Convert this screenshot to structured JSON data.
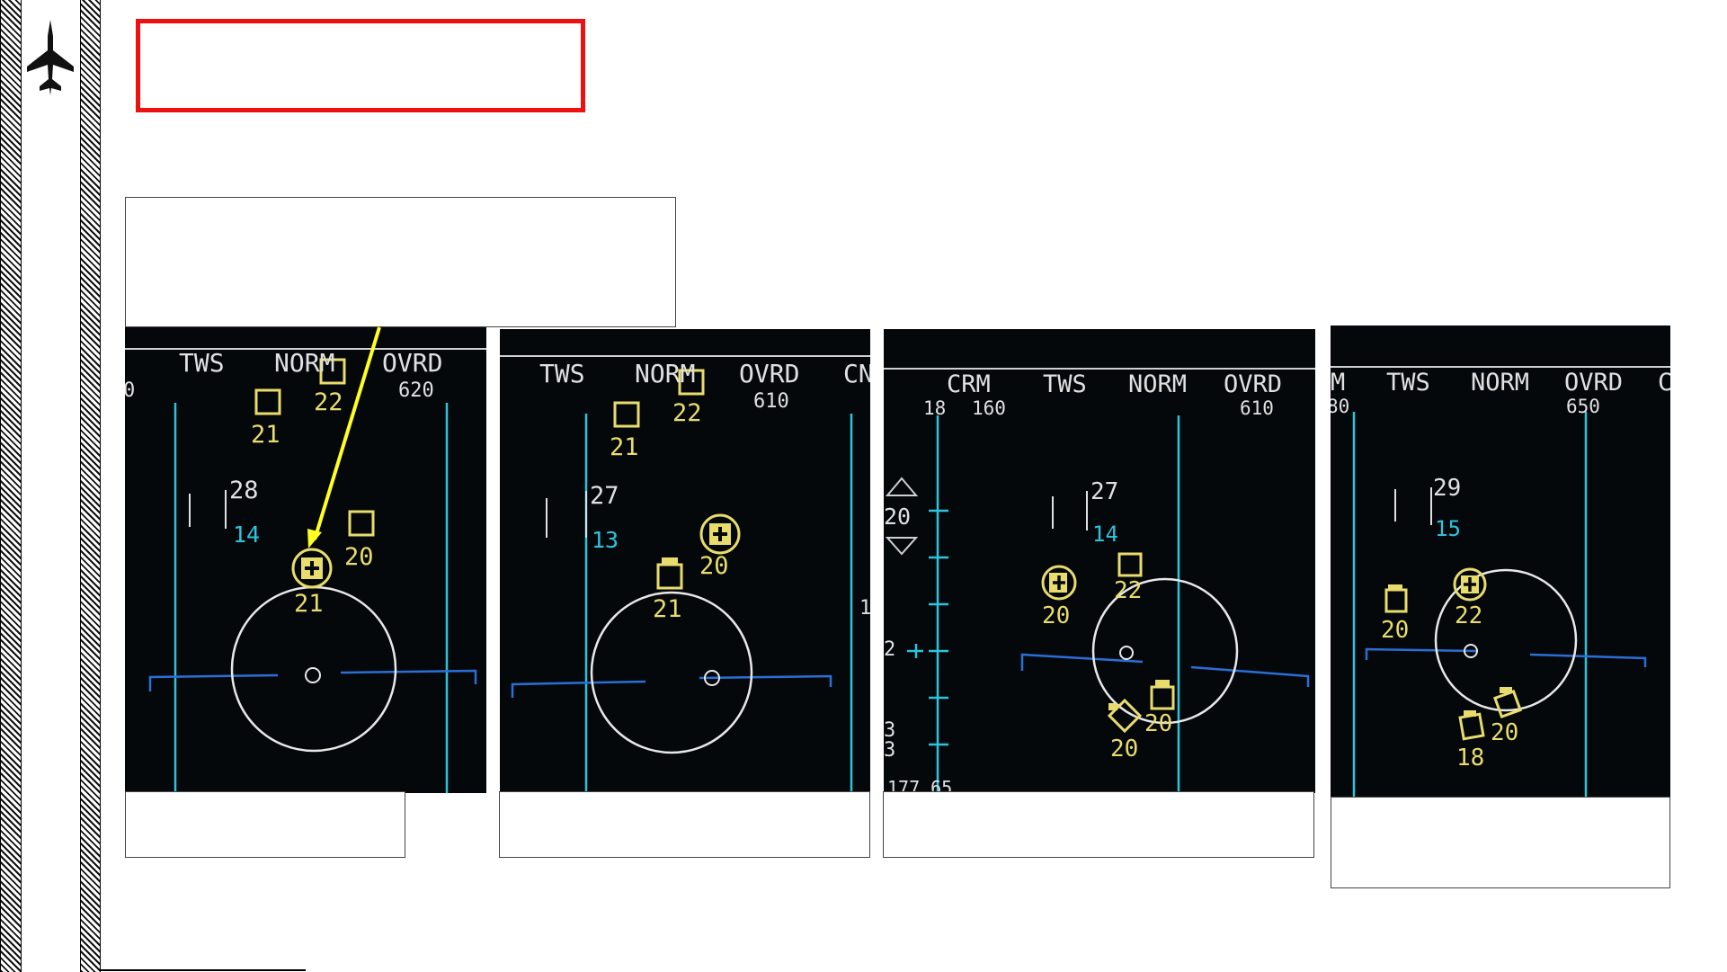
{
  "colors": {
    "title_box_border": "#ee1111",
    "panel_bg": "#05080b",
    "symbol_yellow": "#e8dc6c",
    "scale_cyan": "#2ec3dc",
    "text_white": "#e0e0e0",
    "pointer_arrow": "#ffff22"
  },
  "sidebar": {
    "logo_icon": "jet-aircraft-icon"
  },
  "panels": [
    {
      "header": {
        "left": "0",
        "mode1": "TWS",
        "mode2": "NORM",
        "mode3": "OVRD",
        "range": "620"
      },
      "aspect": {
        "top": "28",
        "bottom": "14"
      },
      "contacts": [
        {
          "label": "21",
          "kind": "square"
        },
        {
          "label": "22",
          "kind": "square"
        },
        {
          "label": "20",
          "kind": "square"
        },
        {
          "label": "21",
          "kind": "tracked"
        }
      ]
    },
    {
      "header": {
        "mode1": "TWS",
        "mode2": "NORM",
        "mode3": "OVRD",
        "right": "CN",
        "range": "610",
        "edge": "1"
      },
      "aspect": {
        "top": "27",
        "bottom": "13"
      },
      "contacts": [
        {
          "label": "21",
          "kind": "square"
        },
        {
          "label": "22",
          "kind": "square"
        },
        {
          "label": "20",
          "kind": "tracked"
        },
        {
          "label": "21",
          "kind": "square"
        }
      ]
    },
    {
      "header": {
        "mode0": "CRM",
        "mode1": "TWS",
        "mode2": "NORM",
        "mode3": "OVRD",
        "scale_top": "18",
        "alt": "160",
        "range": "610"
      },
      "left_scale": {
        "value": "20",
        "mark": "2",
        "bottom_a": "3",
        "bottom_b": "3",
        "footer": "177 65"
      },
      "aspect": {
        "top": "27",
        "bottom": "14"
      },
      "contacts": [
        {
          "label": "20",
          "kind": "tracked"
        },
        {
          "label": "22",
          "kind": "square"
        },
        {
          "label": "20",
          "kind": "square"
        },
        {
          "label": "20",
          "kind": "diamond"
        }
      ]
    },
    {
      "header": {
        "left": "M",
        "mode1": "TWS",
        "mode2": "NORM",
        "mode3": "OVRD",
        "right": "C",
        "sub_left": "80",
        "range": "650"
      },
      "aspect": {
        "top": "29",
        "bottom": "15"
      },
      "contacts": [
        {
          "label": "20",
          "kind": "square"
        },
        {
          "label": "22",
          "kind": "tracked"
        },
        {
          "label": "20",
          "kind": "square"
        },
        {
          "label": "18",
          "kind": "square"
        }
      ]
    }
  ]
}
